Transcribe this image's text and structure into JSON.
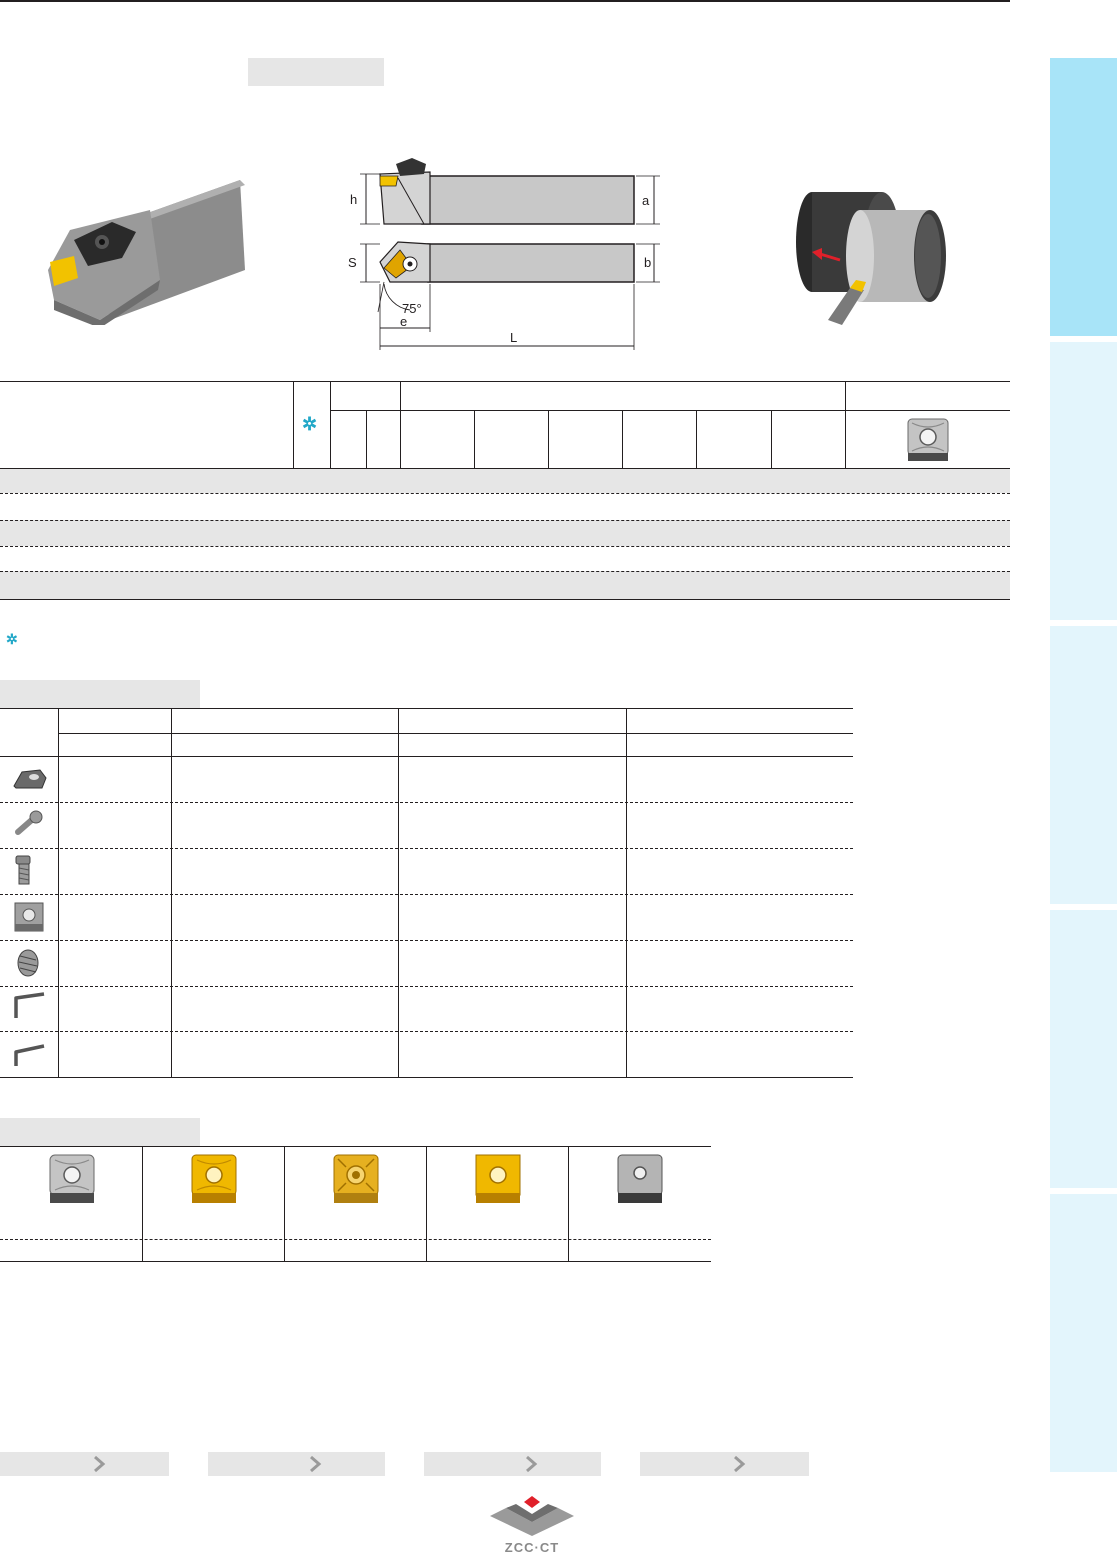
{
  "page": {
    "marker_symbol": "✲",
    "dimension_labels": {
      "h": "h",
      "a": "a",
      "s": "S",
      "b": "b",
      "angle": "75°",
      "e": "e",
      "l": "L"
    },
    "logo_text": "ZCC·CT"
  },
  "colors": {
    "tab_active": "#a8e4f8",
    "tab_inactive": "#e3f5fc",
    "header_gray": "#e6e6e6",
    "accent_cyan": "#22a8c8",
    "insert_gold": "#e0a400",
    "logo_red": "#e0202a",
    "logo_gray": "#808080"
  },
  "icons": {
    "parts": [
      "clamp-icon",
      "pin-icon",
      "screw-icon",
      "shim-icon",
      "spring-icon",
      "key-icon",
      "key-icon"
    ],
    "inserts": [
      "insert-silver-chipbreaker-icon",
      "insert-gold-chipbreaker-icon",
      "insert-gold-pattern-icon",
      "insert-gold-plain-icon",
      "insert-gray-plain-icon"
    ]
  }
}
